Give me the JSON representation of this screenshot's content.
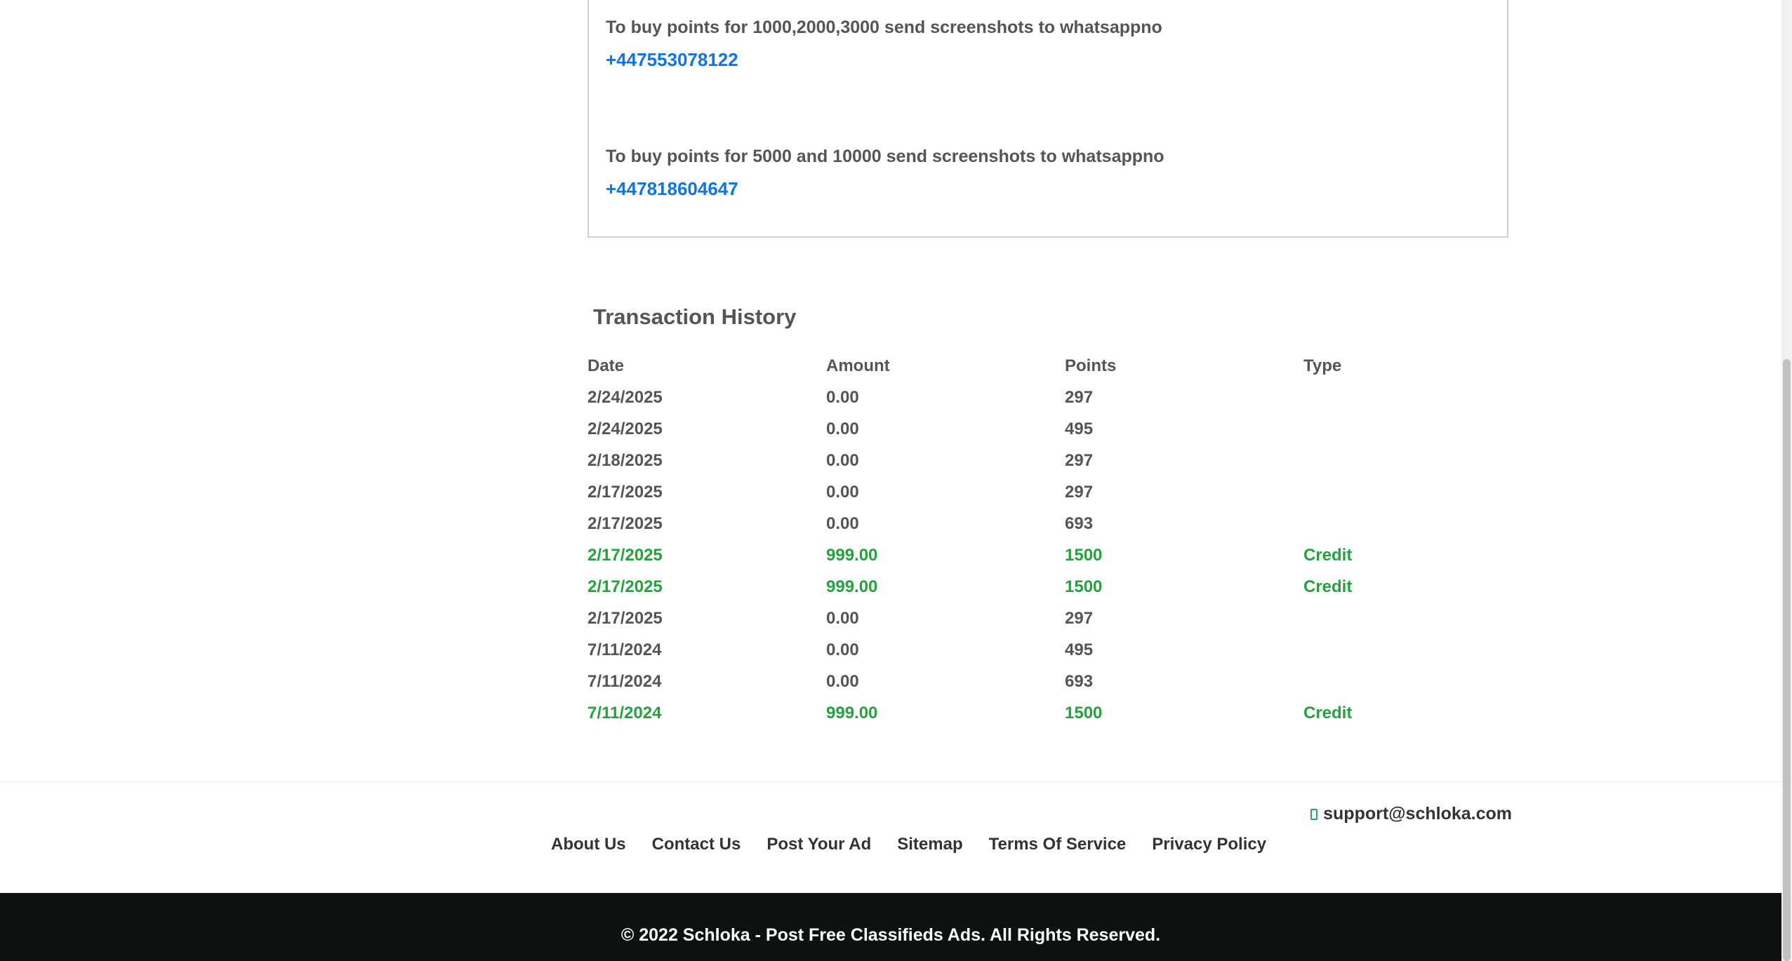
{
  "info": {
    "line1": "To buy points for 1000,2000,3000 send screenshots to whatsappno",
    "phone1": "+447553078122",
    "line2": "To buy points for 5000 and 10000 send screenshots to whatsappno",
    "phone2": "+447818604647"
  },
  "transactions": {
    "title": "Transaction History",
    "headers": {
      "date": "Date",
      "amount": "Amount",
      "points": "Points",
      "type": "Type"
    },
    "rows": [
      {
        "date": "2/24/2025",
        "amount": "0.00",
        "points": "297",
        "type": ""
      },
      {
        "date": "2/24/2025",
        "amount": "0.00",
        "points": "495",
        "type": ""
      },
      {
        "date": "2/18/2025",
        "amount": "0.00",
        "points": "297",
        "type": ""
      },
      {
        "date": "2/17/2025",
        "amount": "0.00",
        "points": "297",
        "type": ""
      },
      {
        "date": "2/17/2025",
        "amount": "0.00",
        "points": "693",
        "type": ""
      },
      {
        "date": "2/17/2025",
        "amount": "999.00",
        "points": "1500",
        "type": "Credit"
      },
      {
        "date": "2/17/2025",
        "amount": "999.00",
        "points": "1500",
        "type": "Credit"
      },
      {
        "date": "2/17/2025",
        "amount": "0.00",
        "points": "297",
        "type": ""
      },
      {
        "date": "7/11/2024",
        "amount": "0.00",
        "points": "495",
        "type": ""
      },
      {
        "date": "7/11/2024",
        "amount": "0.00",
        "points": "693",
        "type": ""
      },
      {
        "date": "7/11/2024",
        "amount": "999.00",
        "points": "1500",
        "type": "Credit"
      }
    ]
  },
  "footer": {
    "support_email": "support@schloka.com",
    "links": [
      "About Us",
      "Contact Us",
      "Post Your Ad",
      "Sitemap",
      "Terms Of Service",
      "Privacy Policy"
    ],
    "copyright": "© 2022 Schloka - Post Free Classifieds Ads. All Rights Reserved."
  },
  "icons": {
    "support": "mail-icon"
  },
  "colors": {
    "link_blue": "#0f74e6",
    "credit_green": "#23a33e",
    "text_gray": "#555555",
    "footer_bar": "#101212"
  }
}
